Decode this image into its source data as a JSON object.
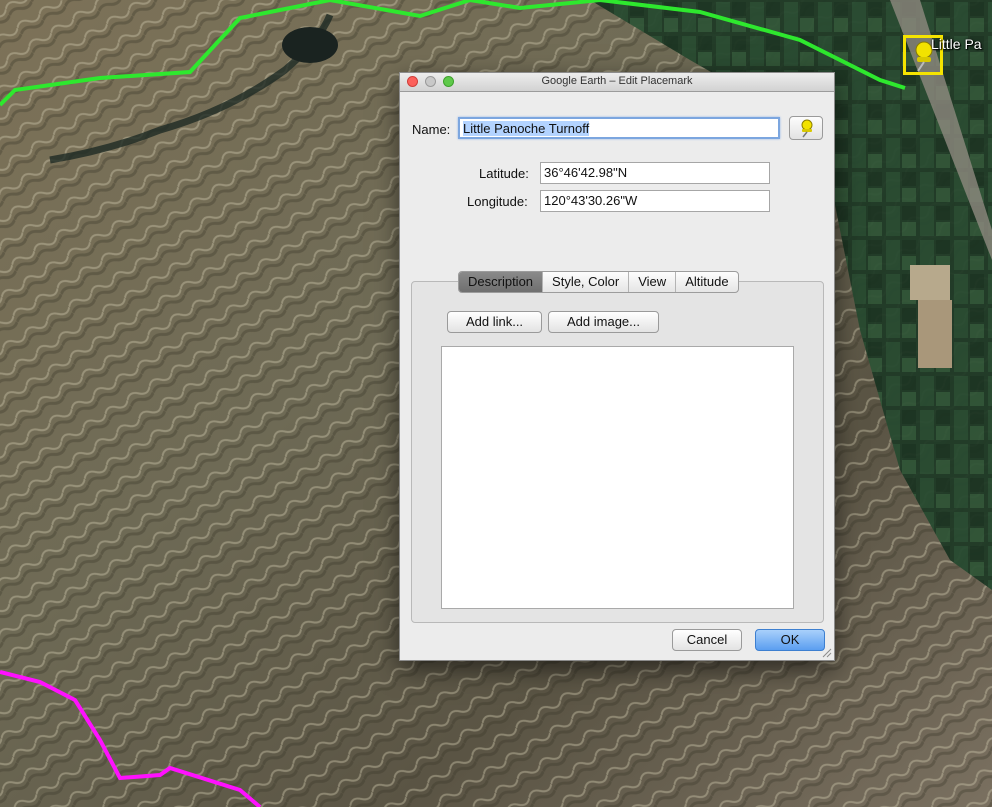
{
  "map": {
    "placemark_label": "Little Pa",
    "colors": {
      "route_green": "#2ee82e",
      "route_magenta": "#ff10ff",
      "highlight_yellow": "#f5e400"
    }
  },
  "dialog": {
    "title": "Google Earth – Edit Placemark",
    "name_label": "Name:",
    "name_value": "Little Panoche Turnoff",
    "latitude_label": "Latitude:",
    "latitude_value": "36°46'42.98\"N",
    "longitude_label": "Longitude:",
    "longitude_value": "120°43'30.26\"W",
    "pin_icon": "yellow-pushpin-icon",
    "tabs": [
      {
        "label": "Description",
        "active": true
      },
      {
        "label": "Style, Color",
        "active": false
      },
      {
        "label": "View",
        "active": false
      },
      {
        "label": "Altitude",
        "active": false
      }
    ],
    "add_link_label": "Add link...",
    "add_image_label": "Add image...",
    "description_text": "",
    "cancel_label": "Cancel",
    "ok_label": "OK"
  }
}
